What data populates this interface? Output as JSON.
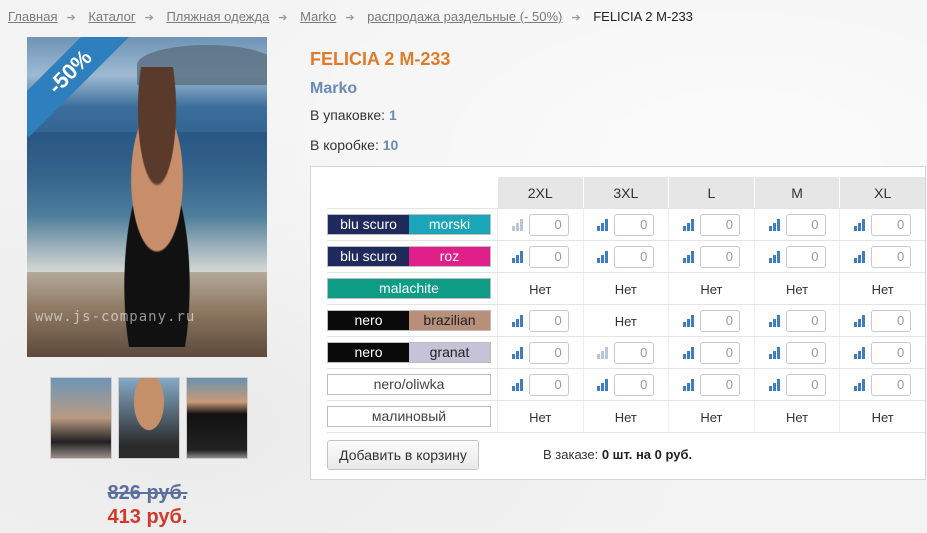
{
  "breadcrumb": {
    "items": [
      "Главная",
      "Каталог",
      "Пляжная одежда",
      "Marko",
      "распродажа раздельные (- 50%)"
    ],
    "current": "FELICIA 2 M-233"
  },
  "product": {
    "discount_badge": "-50%",
    "watermark": "www.js-company.ru",
    "title": "FELICIA 2 M-233",
    "brand": "Marko",
    "pack_label": "В упаковке:",
    "pack_value": "1",
    "box_label": "В коробке:",
    "box_value": "10",
    "old_price": "826 руб.",
    "new_price": "413 руб."
  },
  "sizes": [
    "2XL",
    "3XL",
    "L",
    "M",
    "XL"
  ],
  "colors": [
    {
      "parts": [
        {
          "text": "blu scuro",
          "bg": "#1f2a5c",
          "fg": "#ffffff"
        },
        {
          "text": "morski",
          "bg": "#1aa6b8",
          "fg": "#ffffff"
        }
      ],
      "cells": [
        "0",
        "0",
        "0",
        "0",
        "0"
      ],
      "stock": [
        "low",
        "full",
        "full",
        "full",
        "full"
      ]
    },
    {
      "parts": [
        {
          "text": "blu scuro",
          "bg": "#1f2a5c",
          "fg": "#ffffff"
        },
        {
          "text": "roz",
          "bg": "#e01f8a",
          "fg": "#ffffff"
        }
      ],
      "cells": [
        "0",
        "0",
        "0",
        "0",
        "0"
      ],
      "stock": [
        "full",
        "full",
        "full",
        "full",
        "full"
      ]
    },
    {
      "parts": [
        {
          "text": "malachite",
          "bg": "#0f9c86",
          "fg": "#ffffff"
        }
      ],
      "cells": [
        "Нет",
        "Нет",
        "Нет",
        "Нет",
        "Нет"
      ],
      "stock": [
        "",
        "",
        "",
        "",
        ""
      ]
    },
    {
      "parts": [
        {
          "text": "nero",
          "bg": "#0a0a0a",
          "fg": "#ffffff"
        },
        {
          "text": "brazilian",
          "bg": "#b78f7b",
          "fg": "#222222"
        }
      ],
      "cells": [
        "0",
        "Нет",
        "0",
        "0",
        "0"
      ],
      "stock": [
        "full",
        "",
        "full",
        "full",
        "full"
      ]
    },
    {
      "parts": [
        {
          "text": "nero",
          "bg": "#0a0a0a",
          "fg": "#ffffff"
        },
        {
          "text": "granat",
          "bg": "#c7c2d8",
          "fg": "#222222"
        }
      ],
      "cells": [
        "0",
        "0",
        "0",
        "0",
        "0"
      ],
      "stock": [
        "full",
        "low",
        "full",
        "full",
        "full"
      ]
    },
    {
      "parts": [
        {
          "text": "nero/oliwka",
          "bg": "#ffffff",
          "fg": "#444444"
        }
      ],
      "cells": [
        "0",
        "0",
        "0",
        "0",
        "0"
      ],
      "stock": [
        "full",
        "full",
        "full",
        "full",
        "full"
      ]
    },
    {
      "parts": [
        {
          "text": "малиновый",
          "bg": "#ffffff",
          "fg": "#444444"
        }
      ],
      "cells": [
        "Нет",
        "Нет",
        "Нет",
        "Нет",
        "Нет"
      ],
      "stock": [
        "",
        "",
        "",
        "",
        ""
      ]
    }
  ],
  "cart": {
    "button_label": "Добавить в корзину",
    "order_label": "В заказе:",
    "order_value": "0 шт. на 0 руб."
  },
  "theme": {
    "accent": "#e07b2a",
    "brand_blue": "#6a8ab8",
    "price_red": "#d03a2a",
    "stock_full": "#3f7cc1",
    "stock_low": "#b7c7db"
  }
}
